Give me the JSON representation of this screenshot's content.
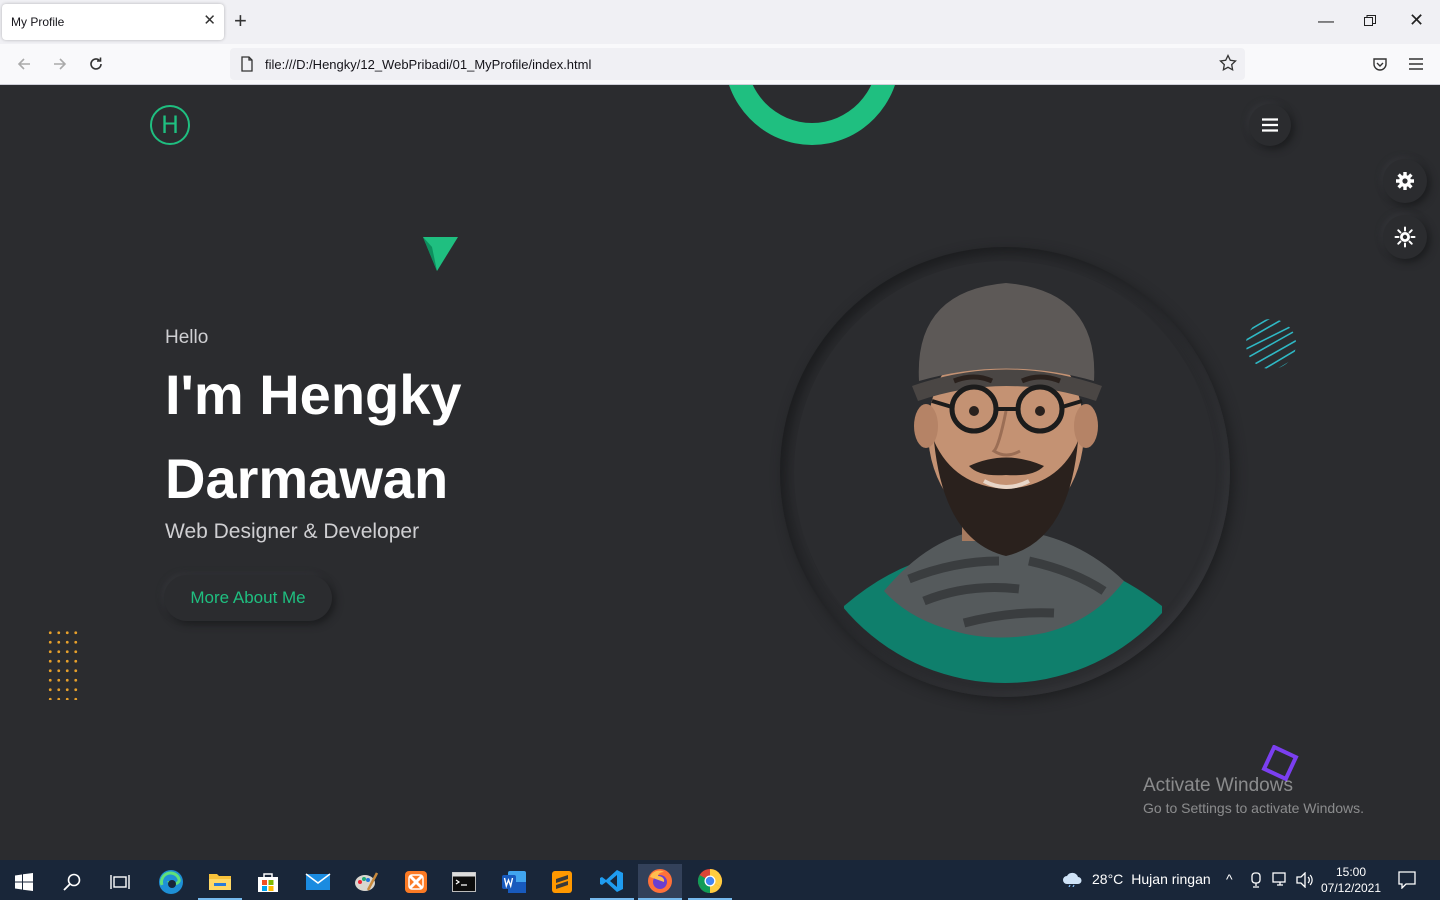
{
  "browser": {
    "tab_title": "My Profile",
    "tab_close": "✕",
    "new_tab": "+",
    "url": "file:///D:/Hengky/12_WebPribadi/01_MyProfile/index.html"
  },
  "page": {
    "logo_letter": "H",
    "hello": "Hello",
    "name": "I'm Hengky Darmawan",
    "role": "Web Designer & Developer",
    "cta_label": "More About Me",
    "accent_color": "#1fbf80"
  },
  "watermark": {
    "title": "Activate Windows",
    "subtitle": "Go to Settings to activate Windows."
  },
  "taskbar": {
    "weather_temp": "28°C",
    "weather_desc": "Hujan ringan",
    "time": "15:00",
    "date": "07/12/2021"
  }
}
